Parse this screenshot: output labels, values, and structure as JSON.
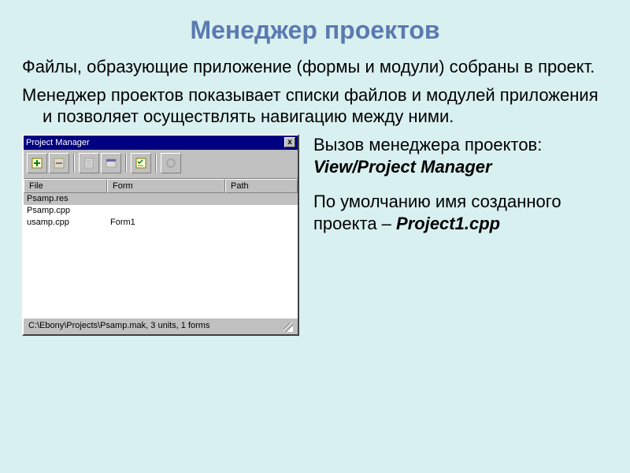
{
  "title": "Менеджер проектов",
  "intro1": "Файлы, образующие приложение (формы и модули) собраны в проект.",
  "intro2": "Менеджер проектов показывает списки файлов и модулей приложения и позволяет осуществлять навигацию между ними.",
  "side": {
    "call_label": "Вызов менеджера проектов:",
    "call_path": "View/Project Manager",
    "default_label": "По умолчанию имя созданного проекта –",
    "default_name": "Project1.cpp"
  },
  "window": {
    "title": "Project Manager",
    "close": "x",
    "columns": {
      "file": "File",
      "form": "Form",
      "path": "Path"
    },
    "rows": [
      {
        "file": "Psamp.res",
        "form": "",
        "path": ""
      },
      {
        "file": "Psamp.cpp",
        "form": "",
        "path": ""
      },
      {
        "file": "usamp.cpp",
        "form": "Form1",
        "path": ""
      }
    ],
    "status": "C:\\Ebony\\Projects\\Psamp.mak, 3 units, 1 forms"
  }
}
